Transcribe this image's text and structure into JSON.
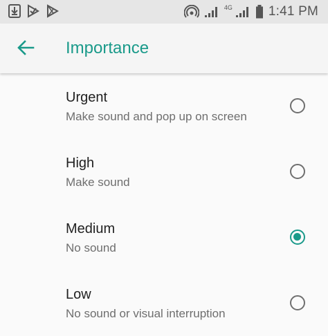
{
  "status_bar": {
    "time": "1:41 PM",
    "network": "4G",
    "icons": [
      "download-icon",
      "check-flag-icon",
      "play-store-icon",
      "hotspot-icon",
      "signal-icon",
      "signal-icon",
      "battery-icon"
    ]
  },
  "header": {
    "title": "Importance",
    "back_icon": "arrow-left-icon"
  },
  "options": [
    {
      "label": "Urgent",
      "description": "Make sound and pop up on screen",
      "selected": false
    },
    {
      "label": "High",
      "description": "Make sound",
      "selected": false
    },
    {
      "label": "Medium",
      "description": "No sound",
      "selected": true
    },
    {
      "label": "Low",
      "description": "No sound or visual interruption",
      "selected": false
    }
  ],
  "colors": {
    "accent": "#1a9a8a",
    "status_bar_bg": "#e6e6e6",
    "app_bar_bg": "#f5f5f5"
  }
}
